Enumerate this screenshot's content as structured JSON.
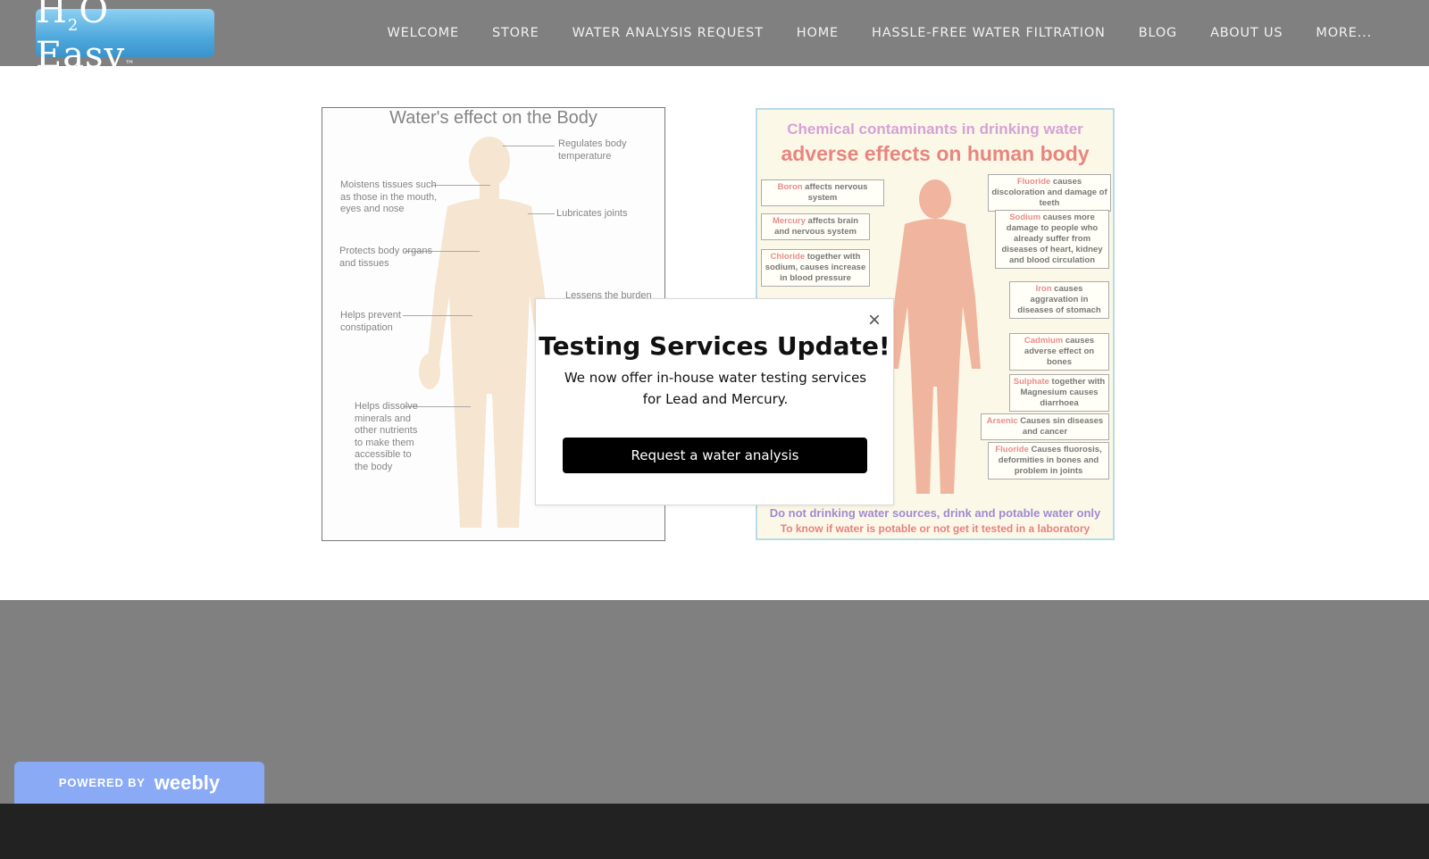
{
  "brand": {
    "logo_main": "H",
    "logo_sub": "2",
    "logo_rest": "O Easy",
    "logo_tm": "™"
  },
  "nav": {
    "items": [
      "WELCOME",
      "STORE",
      "WATER ANALYSIS REQUEST",
      "HOME",
      "HASSLE-FREE WATER FILTRATION",
      "BLOG",
      "ABOUT US",
      "MORE..."
    ]
  },
  "figure_left": {
    "title": "Water's effect on the Body",
    "labels": {
      "l1": "Regulates body temperature",
      "l2": "Moistens tissues such as those in the mouth, eyes and nose",
      "l3": "Lubricates joints",
      "l4": "Protects body organs and tissues",
      "l5": "Lessens the burden",
      "l6": "Helps prevent constipation",
      "l7": "Helps dissolve minerals and other nutrients to make them accessible to the body"
    }
  },
  "figure_right": {
    "title1": "Chemical contaminants in drinking water",
    "title2": "adverse effects on human body",
    "boxes": {
      "boron_el": "Boron",
      "boron_tx": " affects nervous system",
      "mercury_el": "Mercury",
      "mercury_tx": " affects brain and nervous system",
      "chloride_el": "Chloride",
      "chloride_tx": " together with sodium, causes increase in blood pressure",
      "fluoride1_el": "Fluoride",
      "fluoride1_tx": " causes discoloration and damage of teeth",
      "sodium_el": "Sodium",
      "sodium_tx": " causes more damage to people who already suffer from diseases of heart, kidney and blood circulation",
      "iron_el": "Iron",
      "iron_tx": " causes aggravation in diseases of stomach",
      "cadmium_el": "Cadmium",
      "cadmium_tx": " causes adverse effect on bones",
      "sulphate_el": "Sulphate",
      "sulphate_tx": " together with Magnesium causes diarrhoea",
      "arsenic_el": "Arsenic",
      "arsenic_tx": " Causes sin diseases and cancer",
      "fluoride2_el": "Fluoride",
      "fluoride2_tx": " Causes fluorosis, deformities in bones and problem in joints"
    },
    "foot1": "Do not drinking water sources, drink and potable water only",
    "foot2": "To know if water is potable or not get it tested in a laboratory"
  },
  "popup": {
    "close": "×",
    "title": "Testing Services Update!",
    "text": "We now offer in-house water testing services for Lead and Mercury.",
    "button": "Request a water analysis"
  },
  "footer": {
    "powered": "POWERED BY",
    "brand": "weebly"
  }
}
